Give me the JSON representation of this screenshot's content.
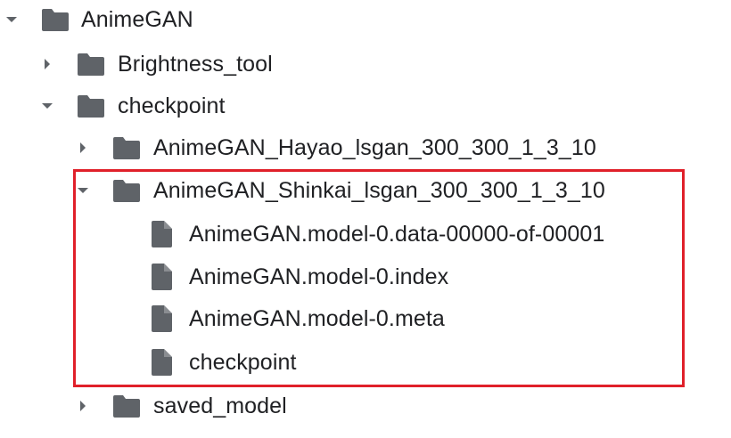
{
  "tree": {
    "root": {
      "label": "AnimeGAN",
      "expanded": true,
      "icon": "folder-icon"
    },
    "brightness_tool": {
      "label": "Brightness_tool",
      "expanded": false,
      "icon": "folder-icon"
    },
    "checkpoint": {
      "label": "checkpoint",
      "expanded": true,
      "icon": "folder-icon"
    },
    "hayao": {
      "label": "AnimeGAN_Hayao_lsgan_300_300_1_3_10",
      "expanded": false,
      "icon": "folder-icon"
    },
    "shinkai": {
      "label": "AnimeGAN_Shinkai_lsgan_300_300_1_3_10",
      "expanded": true,
      "icon": "folder-icon"
    },
    "files": [
      {
        "label": "AnimeGAN.model-0.data-00000-of-00001",
        "icon": "file-icon"
      },
      {
        "label": "AnimeGAN.model-0.index",
        "icon": "file-icon"
      },
      {
        "label": "AnimeGAN.model-0.meta",
        "icon": "file-icon"
      },
      {
        "label": "checkpoint",
        "icon": "file-icon"
      }
    ],
    "saved_model": {
      "label": "saved_model",
      "expanded": false,
      "icon": "folder-icon"
    }
  },
  "colors": {
    "icon": "#5f6368",
    "text": "#202124",
    "highlight_border": "#e0202a"
  }
}
